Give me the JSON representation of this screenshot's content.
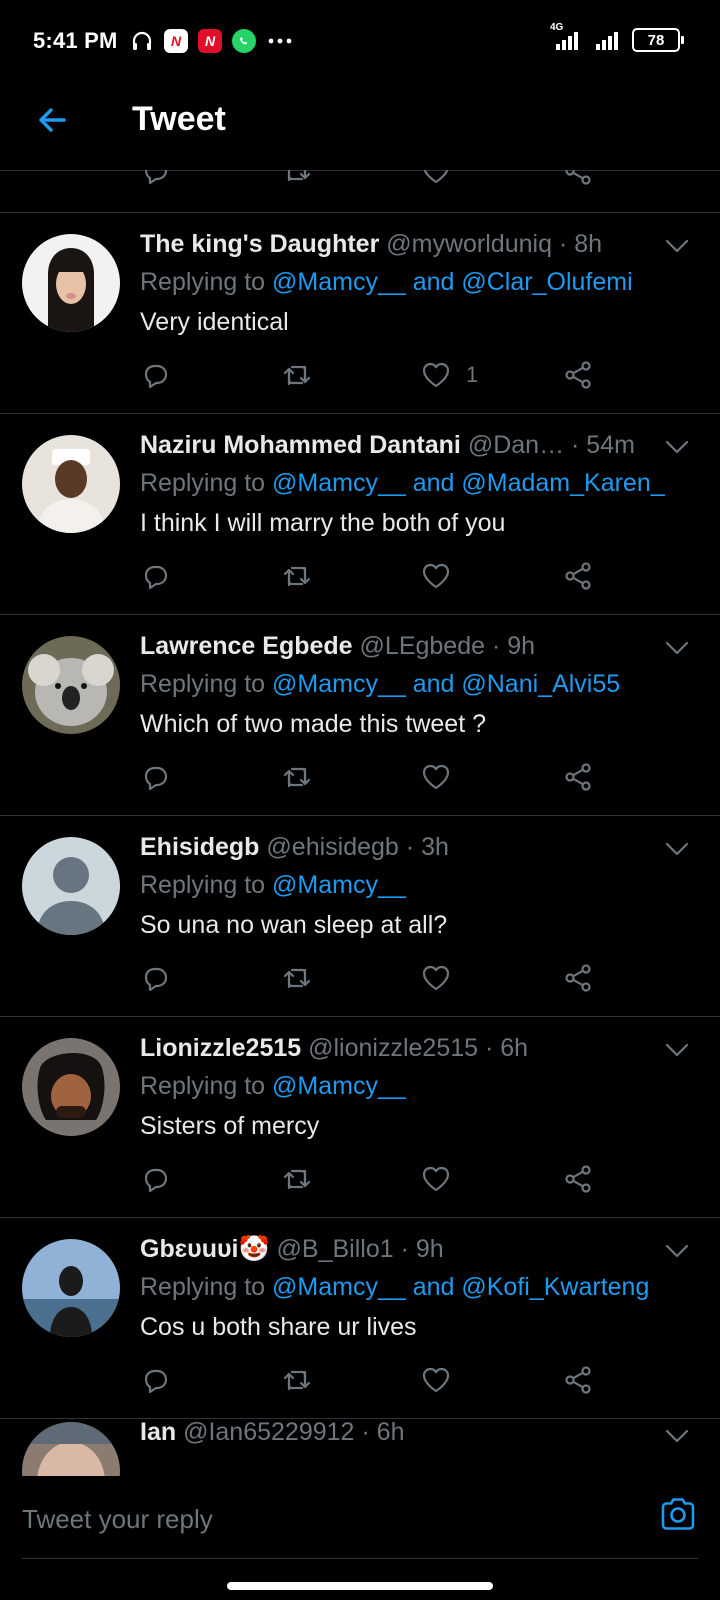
{
  "status_bar": {
    "time": "5:41 PM",
    "network": "4G",
    "battery": "78"
  },
  "header": {
    "title": "Tweet"
  },
  "tweets": [
    {
      "name": "The king's Daughter",
      "handle": "@myworlduniq",
      "time": "· 8h",
      "replying_prefix": "Replying to",
      "mentions": "@Mamcy__ and @Clar_Olufemi",
      "text": "Very identical",
      "likes": "1"
    },
    {
      "name": "Naziru Mohammed Dantani",
      "handle": "@Dan…",
      "time": "· 54m",
      "replying_prefix": "Replying to",
      "mentions": "@Mamcy__ and @Madam_Karen_",
      "text": "I think I will marry the both of you",
      "likes": ""
    },
    {
      "name": "Lawrence Egbede",
      "handle": "@LEgbede",
      "time": "· 9h",
      "replying_prefix": "Replying to",
      "mentions": "@Mamcy__ and @Nani_Alvi55",
      "text": "Which of two made this tweet ?",
      "likes": ""
    },
    {
      "name": "Ehisidegb",
      "handle": "@ehisidegb",
      "time": "· 3h",
      "replying_prefix": "Replying to",
      "mentions": "@Mamcy__",
      "text": "So una no wan sleep at all?",
      "likes": ""
    },
    {
      "name": "Lionizzle2515",
      "handle": "@lionizzle2515",
      "time": "· 6h",
      "replying_prefix": "Replying to",
      "mentions": "@Mamcy__",
      "text": "Sisters of mercy",
      "likes": ""
    },
    {
      "name": "Gbɛυuυi🤡",
      "handle": "@B_Billo1",
      "time": "· 9h",
      "replying_prefix": "Replying to",
      "mentions": "@Mamcy__ and @Kofi_Kwarteng",
      "text": "Cos u both share ur lives",
      "likes": ""
    }
  ],
  "partial_tweet": {
    "name": "Ian",
    "handle": "@Ian65229912",
    "time": "· 6h"
  },
  "reply_bar": {
    "placeholder": "Tweet your reply"
  },
  "colors": {
    "accent": "#1d9bf0",
    "muted": "#6e767d",
    "divider": "#2f3336"
  },
  "icons": [
    "back-arrow-icon",
    "reply-icon",
    "retweet-icon",
    "like-icon",
    "share-icon",
    "chevron-down-icon",
    "camera-icon"
  ]
}
